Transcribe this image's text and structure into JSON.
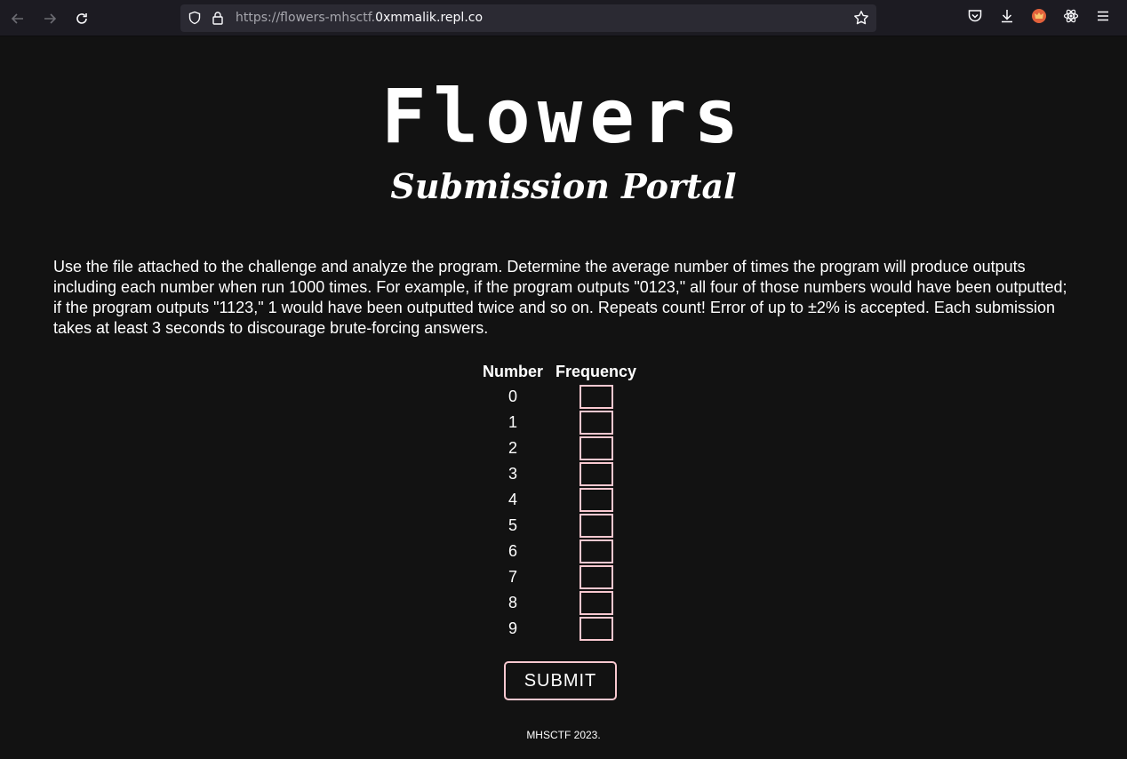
{
  "browser": {
    "url_prefix": "https://flowers-mhsctf.",
    "url_domain": "0xmmalik.repl.co"
  },
  "page": {
    "title": "Flowers",
    "subtitle": "Submission Portal",
    "description": "Use the file attached to the challenge and analyze the program. Determine the average number of times the program will produce outputs including each number when run 1000 times. For example, if the program outputs \"0123,\" all four of those numbers would have been outputted; if the program outputs \"1123,\" 1 would have been outputted twice and so on. Repeats count! Error of up to ±2% is accepted. Each submission takes at least 3 seconds to discourage brute-forcing answers.",
    "table": {
      "col_number": "Number",
      "col_frequency": "Frequency",
      "rows": [
        {
          "number": "0",
          "value": ""
        },
        {
          "number": "1",
          "value": ""
        },
        {
          "number": "2",
          "value": ""
        },
        {
          "number": "3",
          "value": ""
        },
        {
          "number": "4",
          "value": ""
        },
        {
          "number": "5",
          "value": ""
        },
        {
          "number": "6",
          "value": ""
        },
        {
          "number": "7",
          "value": ""
        },
        {
          "number": "8",
          "value": ""
        },
        {
          "number": "9",
          "value": ""
        }
      ]
    },
    "submit_label": "SUBMIT",
    "footer": "MHSCTF 2023."
  },
  "colors": {
    "background": "#121212",
    "accent_border": "#f8c8d0",
    "toolbar": "#1c1b22"
  },
  "icons": [
    "back-icon",
    "forward-icon",
    "reload-icon",
    "shield-icon",
    "lock-icon",
    "bookmark-star-icon",
    "pocket-icon",
    "download-icon",
    "extension-fox-icon",
    "react-devtools-icon",
    "menu-icon"
  ]
}
